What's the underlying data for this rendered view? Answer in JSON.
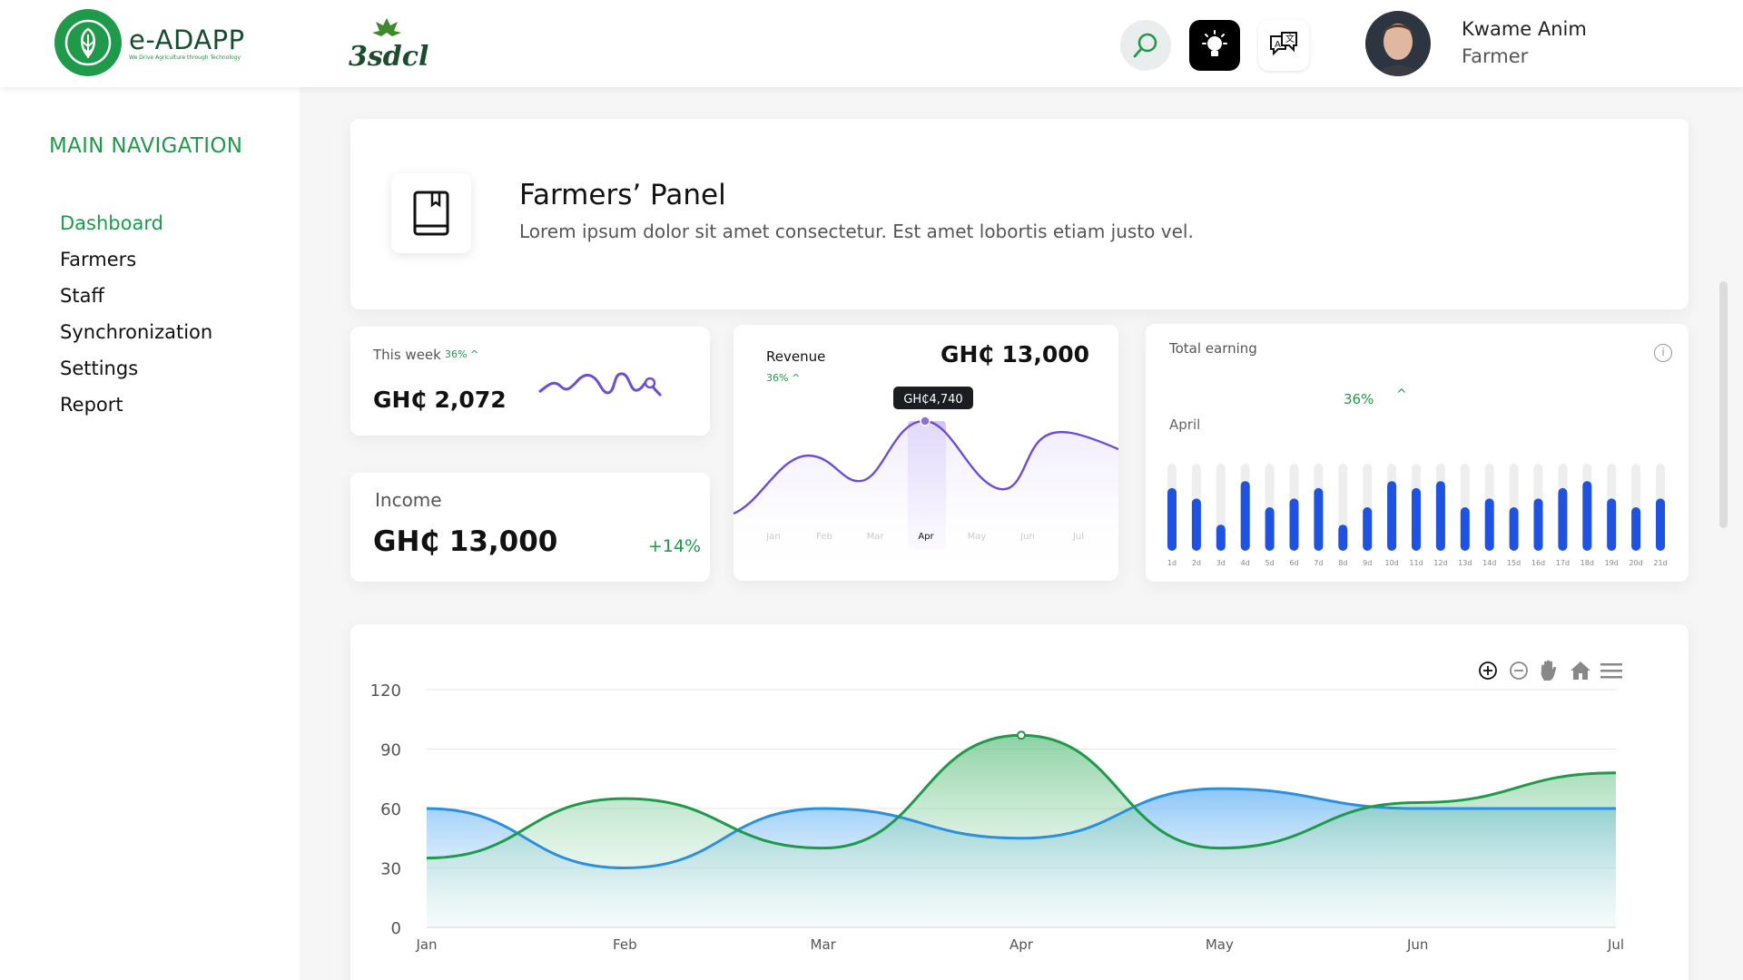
{
  "header": {
    "brand_name": "e-ADAPP",
    "brand_tagline": "We Drive Agriculture through Technology",
    "partner_name": "3sdcl",
    "user_name": "Kwame Anim",
    "user_role": "Farmer",
    "icons": [
      "search-icon",
      "bulb-icon",
      "translate-icon"
    ]
  },
  "sidebar": {
    "heading": "MAIN NAVIGATION",
    "items": [
      {
        "label": "Dashboard",
        "active": true
      },
      {
        "label": "Farmers",
        "active": false
      },
      {
        "label": "Staff",
        "active": false
      },
      {
        "label": "Synchronization",
        "active": false
      },
      {
        "label": "Settings",
        "active": false
      },
      {
        "label": "Report",
        "active": false
      }
    ]
  },
  "panel": {
    "title": "Farmers’ Panel",
    "description": "Lorem ipsum dolor sit amet consectetur. Est amet lobortis etiam justo vel."
  },
  "week": {
    "label": "This week",
    "change": "36%",
    "value": "GH₵ 2,072"
  },
  "income": {
    "label": "Income",
    "value": "GH₵ 13,000",
    "change": "+14%"
  },
  "revenue": {
    "label": "Revenue",
    "change": "36%",
    "value": "GH₵ 13,000",
    "tooltip": "GH₵4,740",
    "months": [
      "Jan",
      "Feb",
      "Mar",
      "Apr",
      "May",
      "Jun",
      "Jul"
    ],
    "highlight": "Apr"
  },
  "earning": {
    "label": "Total earning",
    "change": "36%",
    "month": "April",
    "days": [
      "1d",
      "2d",
      "3d",
      "4d",
      "5d",
      "6d",
      "7d",
      "8d",
      "9d",
      "10d",
      "11d",
      "12d",
      "13d",
      "14d",
      "15d",
      "16d",
      "17d",
      "18d",
      "19d",
      "20d",
      "21d"
    ],
    "values": [
      0.72,
      0.6,
      0.3,
      0.8,
      0.5,
      0.6,
      0.72,
      0.3,
      0.5,
      0.8,
      0.72,
      0.8,
      0.5,
      0.6,
      0.5,
      0.6,
      0.72,
      0.8,
      0.6,
      0.5,
      0.6
    ]
  },
  "colors": {
    "brand_green": "#1f9a4a",
    "series_green": "#1f9a4a",
    "series_blue": "#2b8fe0",
    "bar_blue": "#1f52e0",
    "revenue_purple": "#6d4cd6"
  },
  "chart_data": {
    "type": "area",
    "categories": [
      "Jan",
      "Feb",
      "Mar",
      "Apr",
      "May",
      "Jun",
      "Jul"
    ],
    "series": [
      {
        "values": [
          60,
          30,
          60,
          45,
          70,
          60,
          60
        ]
      },
      {
        "values": [
          35,
          65,
          40,
          97,
          40,
          63,
          78
        ]
      }
    ],
    "ylim": [
      0,
      120
    ],
    "yticks": [
      0,
      30,
      60,
      90,
      120
    ],
    "grid": true,
    "toolbar": [
      "zoom-in-icon",
      "zoom-out-icon",
      "pan-hand-icon",
      "home-icon",
      "menu-icon"
    ]
  }
}
